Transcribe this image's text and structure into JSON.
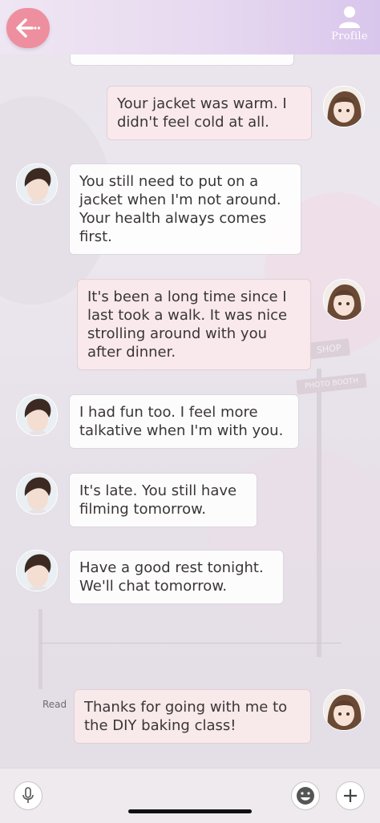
{
  "header": {
    "profile_label": "Profile"
  },
  "messages": [
    {
      "sender": "him",
      "text": ""
    },
    {
      "sender": "me",
      "text": "Your jacket was warm. I didn't feel cold at all."
    },
    {
      "sender": "him",
      "text": "You still need to put on a jacket when I'm not around. Your health always comes first."
    },
    {
      "sender": "me",
      "text": "It's been a long time since I last took a walk. It was nice strolling around with you after dinner."
    },
    {
      "sender": "him",
      "text": "I had fun too. I feel more talkative when I'm with you."
    },
    {
      "sender": "him",
      "text": "It's late. You still have filming tomorrow."
    },
    {
      "sender": "him",
      "text": "Have a good rest tonight. We'll chat tomorrow."
    },
    {
      "sender": "me",
      "text": "Thanks for going with me to the DIY baking class!",
      "status": "Read"
    }
  ],
  "background_signs": [
    "SHOP",
    "PHOTO BOOTH"
  ],
  "colors": {
    "accent": "#ee8fa0",
    "header": "#e7d9f0",
    "my_bubble": "#fae9ec"
  },
  "icons": [
    "back-arrow-icon",
    "profile-icon",
    "microphone-icon",
    "emoji-icon",
    "plus-icon"
  ]
}
